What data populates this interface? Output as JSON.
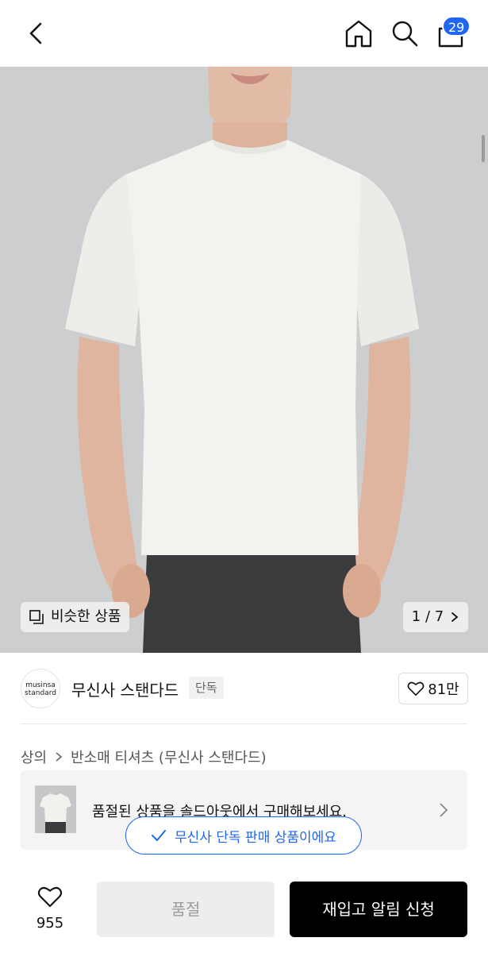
{
  "header": {
    "cart_count": "29",
    "icons": [
      "back-icon",
      "home-icon",
      "search-icon",
      "cart-icon"
    ]
  },
  "hero": {
    "similar_label": "비슷한 상품",
    "page_indicator": "1 / 7"
  },
  "brand": {
    "logo_line1": "musinsa",
    "logo_line2": "standard",
    "name": "무신사 스탠다드",
    "tag": "단독",
    "likes": "81만"
  },
  "breadcrumb": {
    "category": "상의",
    "subcategory": "반소매 티셔츠 (무신사 스탠다드)"
  },
  "banner": {
    "text": "품절된 상품을 솔드아웃에서 구매해보세요."
  },
  "toast": {
    "text": "무신사 단독 판매 상품이에요"
  },
  "bottom": {
    "like_count": "955",
    "soldout_label": "품절",
    "restock_label": "재입고 알림 신청"
  },
  "colors": {
    "accent": "#1f66f1",
    "primary_button": "#000000",
    "disabled_button": "#ededed"
  }
}
